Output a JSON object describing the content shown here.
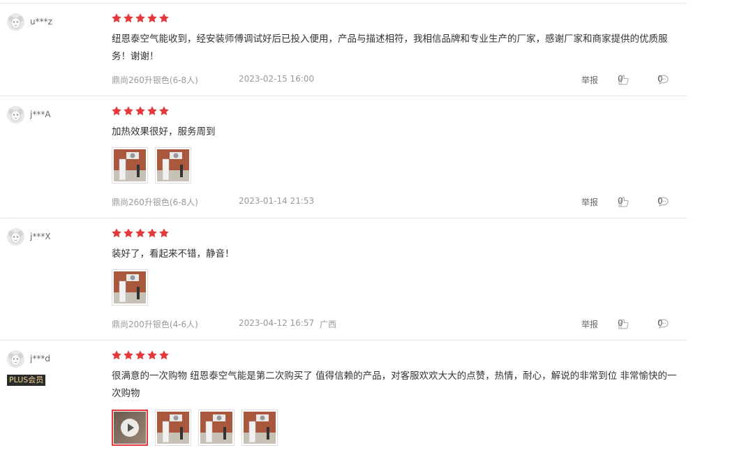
{
  "reviews": [
    {
      "user": "u***z",
      "plus": "",
      "rating": 5,
      "text": "纽恩泰空气能收到，经安装师傅调试好后已投入便用，产品与描述相符，我相信品牌和专业生产的厂家，感谢厂家和商家提供的优质服务！谢谢！",
      "photos": [],
      "spec": "鼎尚260升银色(6-8人)",
      "date": "2023-02-15 16:00",
      "region": "",
      "report": "举报",
      "likes": "0",
      "comments": "0"
    },
    {
      "user": "j***A",
      "plus": "",
      "rating": 5,
      "text": "加热效果很好，服务周到",
      "photos": [
        "photo",
        "photo"
      ],
      "spec": "鼎尚260升银色(6-8人)",
      "date": "2023-01-14 21:53",
      "region": "",
      "report": "举报",
      "likes": "0",
      "comments": "0"
    },
    {
      "user": "j***X",
      "plus": "",
      "rating": 5,
      "text": "装好了，看起来不错，静音！",
      "photos": [
        "photo"
      ],
      "spec": "鼎尚200升银色(4-6人)",
      "date": "2023-04-12 16:57",
      "region": "广西",
      "report": "举报",
      "likes": "0",
      "comments": "0"
    },
    {
      "user": "j***d",
      "plus": "PLUS会员",
      "rating": 5,
      "text": "很满意的一次购物 纽恩泰空气能是第二次购买了 值得信赖的产品，对客服欢欢大大的点赞，热情，耐心，解说的非常到位 非常愉快的一次购物",
      "photos": [
        "video",
        "photo",
        "photo",
        "photo"
      ],
      "spec": "",
      "date": "",
      "region": "",
      "report": "",
      "likes": "",
      "comments": ""
    }
  ],
  "colors": {
    "star": "#e4393c",
    "plus_bg": "#2b2b2b",
    "plus_text": "#f5d78e"
  }
}
